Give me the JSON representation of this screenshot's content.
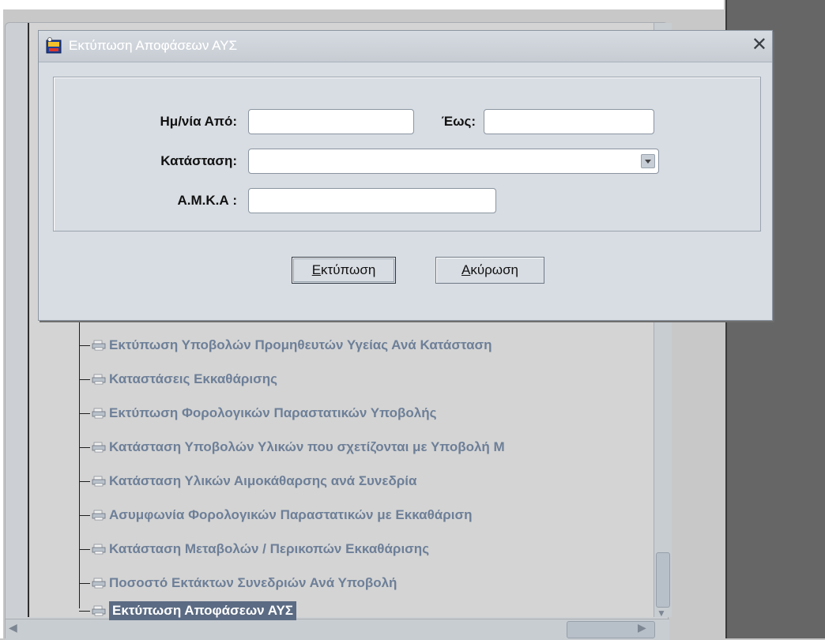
{
  "dialog": {
    "title": "Εκτύπωση Αποφάσεων ΑΥΣ",
    "close_icon": "close-icon",
    "date_from_label": "Ημ/νία Από:",
    "date_from_value": "",
    "date_to_label": "Έως:",
    "date_to_value": "",
    "status_label": "Κατάσταση:",
    "status_value": "",
    "amka_label": "Α.Μ.Κ.Α :",
    "amka_value": "",
    "print_button": {
      "mnemonic": "Ε",
      "rest": "κτύπωση"
    },
    "cancel_button": {
      "mnemonic": "Α",
      "rest": "κύρωση"
    }
  },
  "tree": {
    "items": [
      {
        "label": "Εκτύπωση Υποβολών Προμηθευτών Υγείας Ανά Κατάσταση",
        "icon": "printer-icon",
        "selected": false
      },
      {
        "label": "Καταστάσεις Εκκαθάρισης",
        "icon": "printer-icon",
        "selected": false
      },
      {
        "label": "Εκτύπωση Φορολογικών Παραστατικών Υποβολής",
        "icon": "printer-icon",
        "selected": false
      },
      {
        "label": "Κατάσταση Υποβολών Υλικών που σχετίζονται με Υποβολή Μ",
        "icon": "printer-icon",
        "selected": false
      },
      {
        "label": "Κατάσταση Υλικών Αιμοκάθαρσης ανά Συνεδρία",
        "icon": "printer-icon",
        "selected": false
      },
      {
        "label": "Ασυμφωνία Φορολογικών Παραστατικών με Εκκαθάριση",
        "icon": "printer-icon",
        "selected": false
      },
      {
        "label": "Κατάσταση Μεταβολών / Περικοπών Εκκαθάρισης",
        "icon": "printer-icon",
        "selected": false
      },
      {
        "label": "Ποσοστό Εκτάκτων Συνεδριών Ανά Υποβολή",
        "icon": "printer-icon",
        "selected": false
      },
      {
        "label": "Εκτύπωση Αποφάσεων ΑΥΣ",
        "icon": "printer-icon",
        "selected": true
      }
    ]
  },
  "colors": {
    "accent": "#5b6b83",
    "tree_text": "#6d7f98",
    "dark_panel": "#666666"
  }
}
